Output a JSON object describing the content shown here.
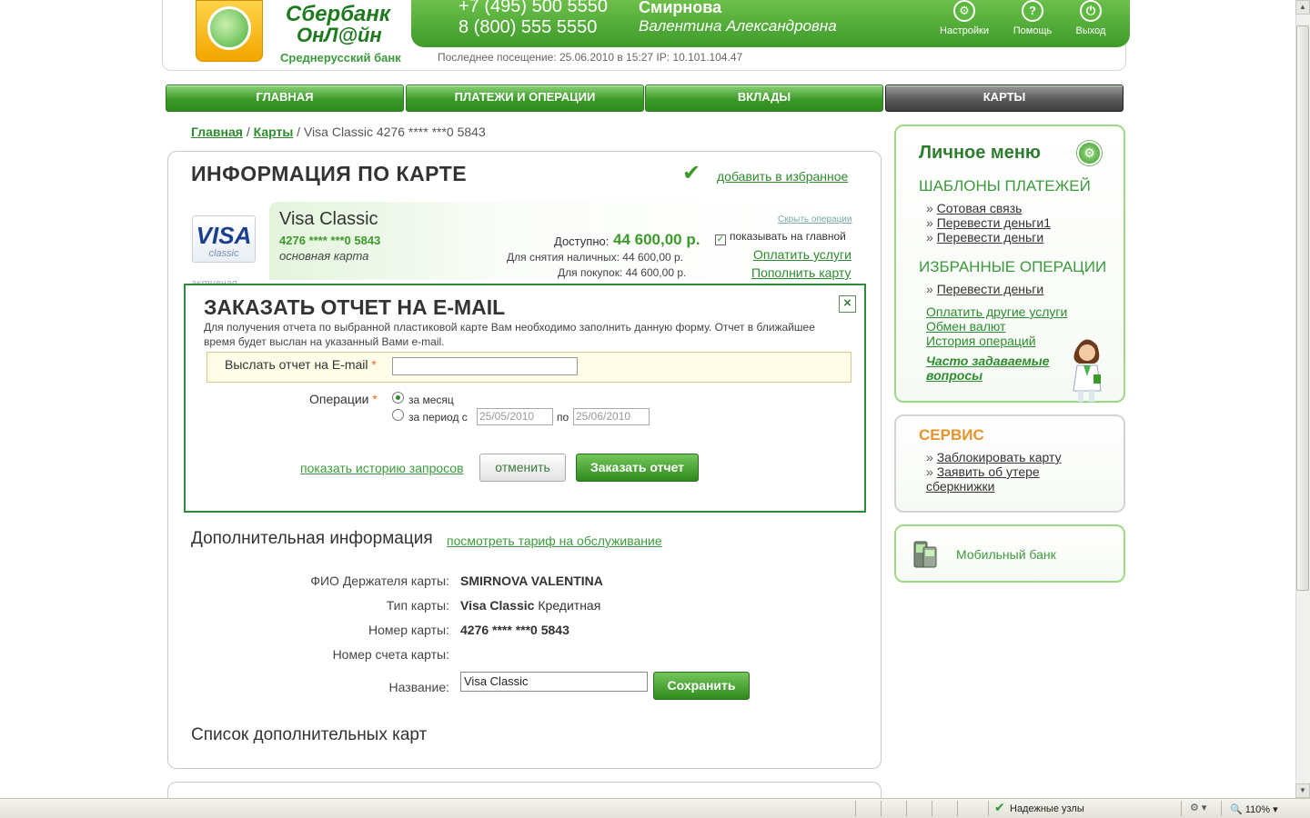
{
  "header": {
    "brand_line1": "Сбербанк",
    "brand_line2": "ОнЛ@йн",
    "brand_sub": "Среднерусский банк",
    "phone1": "+7 (495) 500 5550",
    "phone2": "8 (800) 555 5550",
    "user_surname": "Смирнова",
    "user_name": "Валентина Александровна",
    "settings_label": "Настройки",
    "help_label": "Помощь",
    "logout_label": "Выход",
    "last_visit": "Последнее посещение: 25.06.2010 в 15:27 IP: 10.101.104.47"
  },
  "nav": {
    "tabs": [
      {
        "label": "ГЛАВНАЯ"
      },
      {
        "label": "ПЛАТЕЖИ И ОПЕРАЦИИ"
      },
      {
        "label": "ВКЛАДЫ"
      },
      {
        "label": "КАРТЫ"
      }
    ]
  },
  "breadcrumb": {
    "home": "Главная",
    "cards": "Карты",
    "current": "Visa Classic 4276 **** ***0 5843"
  },
  "card_info": {
    "title": "ИНФОРМАЦИЯ ПО КАРТЕ",
    "add_favorite": "добавить в избранное",
    "visa_logo": "VISA",
    "visa_sub": "classic",
    "card_name": "Visa Classic",
    "card_number": "4276 **** ***0 5843",
    "card_type": "основная карта",
    "available_label": "Доступно:",
    "available_value": "44 600,00 р.",
    "cash_label": "Для снятия наличных: 44 600,00 р.",
    "purchase_label": "Для покупок: 44 600,00 р.",
    "hide_ops": "Скрыть операции",
    "show_on_main": "показывать на главной",
    "pay_services": "Оплатить услуги",
    "top_up": "Пополнить карту",
    "status": "активная"
  },
  "dialog": {
    "title": "ЗАКАЗАТЬ ОТЧЕТ НА E-MAIL",
    "description": "Для получения отчета по выбранной пластиковой карте Вам необходимо заполнить данную форму. Отчет в ближайшее время будет выслан на указанный Вами e-mail.",
    "email_label": "Выслать отчет на E-mail",
    "required_mark": "*",
    "email_value": "",
    "operations_label": "Операции",
    "radio_month": "за месяц",
    "radio_period": "за период с",
    "date_from": "25/05/2010",
    "date_to_label": "по",
    "date_to": "25/06/2010",
    "history_link": "показать историю запросов",
    "cancel": "отменить",
    "order": "Заказать отчет"
  },
  "additional": {
    "title": "Дополнительная информация",
    "tariff_link": "посмотреть тариф на обслуживание",
    "holder_label": "ФИО Держателя карты:",
    "holder_value": "SMIRNOVA VALENTINA",
    "type_label": "Тип карты:",
    "type_value_bold": "Visa Classic",
    "type_value_rest": "Кредитная",
    "number_label": "Номер карты:",
    "number_value": "4276 **** ***0 5843",
    "account_label": "Номер счета карты:",
    "name_label": "Название:",
    "name_value": "Visa Classic",
    "save": "Сохранить",
    "extra_cards_title": "Список дополнительных карт"
  },
  "sidebar": {
    "personal_menu": "Личное меню",
    "templates_title": "ШАБЛОНЫ ПЛАТЕЖЕЙ",
    "templates": [
      "Сотовая связь",
      "Перевести деньги1",
      "Перевести деньги"
    ],
    "favorites_title": "ИЗБРАННЫЕ ОПЕРАЦИИ",
    "favorites": [
      "Перевести деньги"
    ],
    "links": [
      "Оплатить другие услуги",
      "Обмен валют",
      "История операций"
    ],
    "faq": "Часто задаваемые вопросы",
    "service_title": "СЕРВИС",
    "service_links": [
      "Заблокировать карту",
      "Заявить об утере сберкнижки"
    ],
    "mobile_bank": "Мобильный банк",
    "bullet": "»"
  },
  "statusbar": {
    "zone": "Надежные узлы",
    "zoom": "110%"
  },
  "colors": {
    "brand_green": "#3e9a2a",
    "link_green": "#2e8b2e",
    "accent_orange": "#e7922a",
    "active_tab": "#5a5a5a"
  }
}
